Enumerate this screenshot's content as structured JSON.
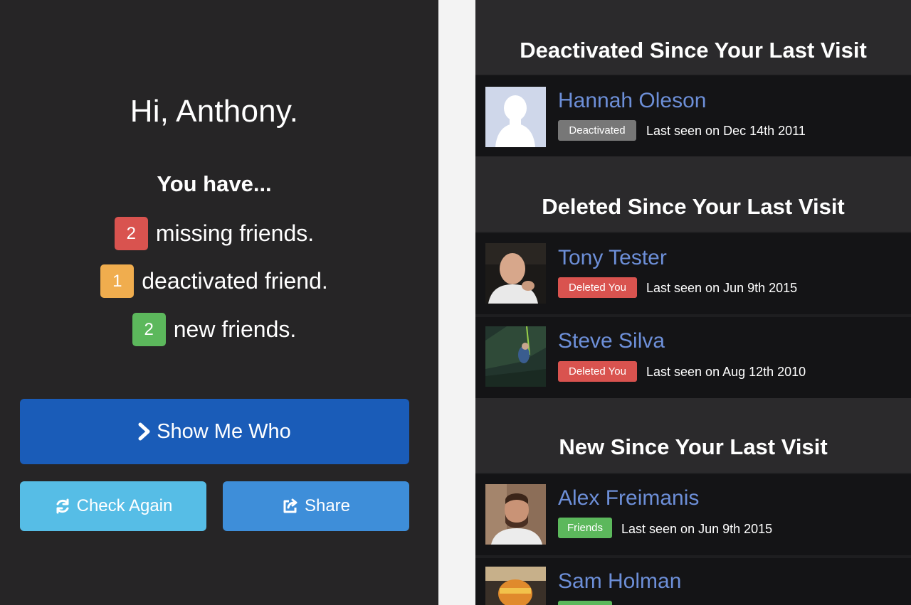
{
  "left": {
    "greeting": "Hi, Anthony.",
    "you_have": "You have...",
    "stats": [
      {
        "count": "2",
        "text": "missing friends.",
        "color": "#d9534f"
      },
      {
        "count": "1",
        "text": "deactivated friend.",
        "color": "#f0ad4e"
      },
      {
        "count": "2",
        "text": "new friends.",
        "color": "#5cb85c"
      }
    ],
    "buttons": {
      "show_me_who": "Show Me Who",
      "check_again": "Check Again",
      "share": "Share"
    },
    "icons": {
      "show": "chevron-right-icon",
      "check": "refresh-icon",
      "share": "share-icon"
    }
  },
  "right": {
    "sections": [
      {
        "title": "Deactivated Since Your Last Visit",
        "people": [
          {
            "name": "Hannah Oleson",
            "tag": "Deactivated",
            "tag_color": "#777777",
            "last_seen": "Last seen on Dec 14th 2011"
          }
        ]
      },
      {
        "title": "Deleted Since Your Last Visit",
        "people": [
          {
            "name": "Tony Tester",
            "tag": "Deleted You",
            "tag_color": "#d9534f",
            "last_seen": "Last seen on Jun 9th 2015"
          },
          {
            "name": "Steve Silva",
            "tag": "Deleted You",
            "tag_color": "#d9534f",
            "last_seen": "Last seen on Aug 12th 2010"
          }
        ]
      },
      {
        "title": "New Since Your Last Visit",
        "people": [
          {
            "name": "Alex Freimanis",
            "tag": "Friends",
            "tag_color": "#5cb85c",
            "last_seen": "Last seen on Jun 9th 2015"
          },
          {
            "name": "Sam Holman",
            "tag": "",
            "tag_color": "#5cb85c",
            "last_seen": ""
          }
        ]
      }
    ]
  },
  "colors": {
    "left_bg": "#262526",
    "right_bg": "#1e1e20",
    "name_link": "#6d8fd8",
    "primary_button": "#1a5cb8",
    "info_button": "#56bde6",
    "share_button": "#3e8ed9"
  }
}
